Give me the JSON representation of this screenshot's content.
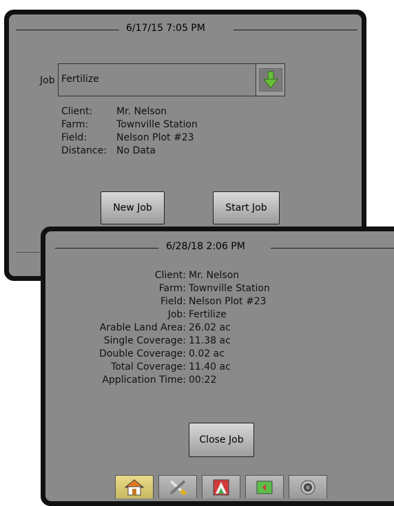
{
  "screen1": {
    "timestamp": "6/17/15 7:05 PM",
    "job_label": "Job",
    "job_value": "Fertilize",
    "details": [
      {
        "key": "Client:",
        "value": "Mr. Nelson"
      },
      {
        "key": "Farm:",
        "value": "Townville Station"
      },
      {
        "key": "Field:",
        "value": "Nelson Plot #23"
      },
      {
        "key": "Distance:",
        "value": "No Data"
      }
    ],
    "new_job_label": "New Job",
    "start_job_label": "Start Job",
    "icons": {
      "dropdown": "down-arrow-icon"
    },
    "colors": {
      "dropdown_arrow": "#6abf3a"
    }
  },
  "screen2": {
    "timestamp": "6/28/18 2:06 PM",
    "details": [
      {
        "key": "Client:",
        "value": "Mr. Nelson"
      },
      {
        "key": "Farm:",
        "value": "Townville Station"
      },
      {
        "key": "Field:",
        "value": "Nelson Plot #23"
      },
      {
        "key": "Job:",
        "value": "Fertilize"
      },
      {
        "key": "Arable Land Area:",
        "value": "26.02 ac"
      },
      {
        "key": "Single Coverage:",
        "value": "11.38 ac"
      },
      {
        "key": "Double Coverage:",
        "value": "0.02 ac"
      },
      {
        "key": "Total Coverage:",
        "value": "11.40 ac"
      },
      {
        "key": "Application Time:",
        "value": "00:22"
      }
    ],
    "close_job_label": "Close Job",
    "nav_tabs": [
      {
        "name": "home",
        "icon": "home-icon",
        "active": true
      },
      {
        "name": "tools",
        "icon": "tools-icon",
        "active": false
      },
      {
        "name": "guidance",
        "icon": "guidance-icon",
        "active": false
      },
      {
        "name": "map",
        "icon": "map-icon",
        "active": false
      },
      {
        "name": "camera",
        "icon": "camera-icon",
        "active": false
      }
    ],
    "colors": {
      "active_tab": "#e2d27a",
      "guidance_red": "#d23b3b",
      "guidance_green": "#3aa84a",
      "map_green": "#5bbf4a"
    }
  }
}
